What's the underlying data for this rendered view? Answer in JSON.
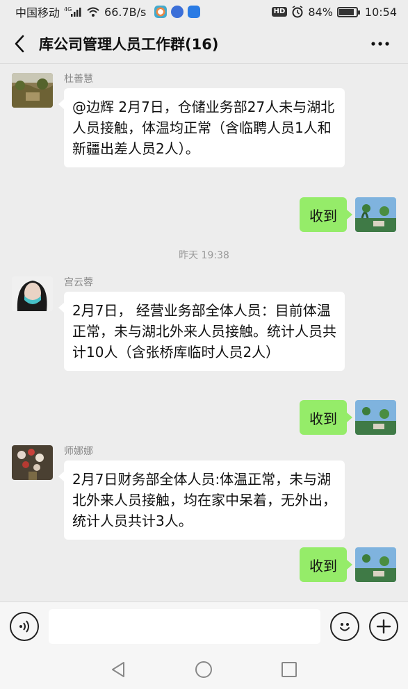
{
  "status_bar": {
    "carrier": "中国移动",
    "network": "4G",
    "speed": "66.7B/s",
    "hd": "HD",
    "battery": "84%",
    "time": "10:54"
  },
  "header": {
    "title": "库公司管理人员工作群(16)",
    "more": "···"
  },
  "messages": [
    {
      "sender": "杜善慧",
      "text": "@边辉 2月7日，仓储业务部27人未与湖北人员接触，体温均正常（含临聘人员1人和新疆出差人员2人）。"
    },
    {
      "reply": "收到"
    },
    {
      "time": "昨天 19:38"
    },
    {
      "sender": "宫云蓉",
      "text": "2月7日， 经营业务部全体人员：目前体温正常，未与湖北外来人员接触。统计人员共计10人（含张桥库临时人员2人）"
    },
    {
      "reply": "收到"
    },
    {
      "sender": "师娜娜",
      "text": "2月7日财务部全体人员:体温正常，未与湖北外来人员接触，均在家中呆着，无外出，统计人员共计3人。"
    },
    {
      "reply": "收到"
    }
  ],
  "input": {
    "value": "",
    "placeholder": ""
  },
  "colors": {
    "background": "#ededed",
    "self_bubble": "#95ec69",
    "other_bubble": "#ffffff"
  }
}
